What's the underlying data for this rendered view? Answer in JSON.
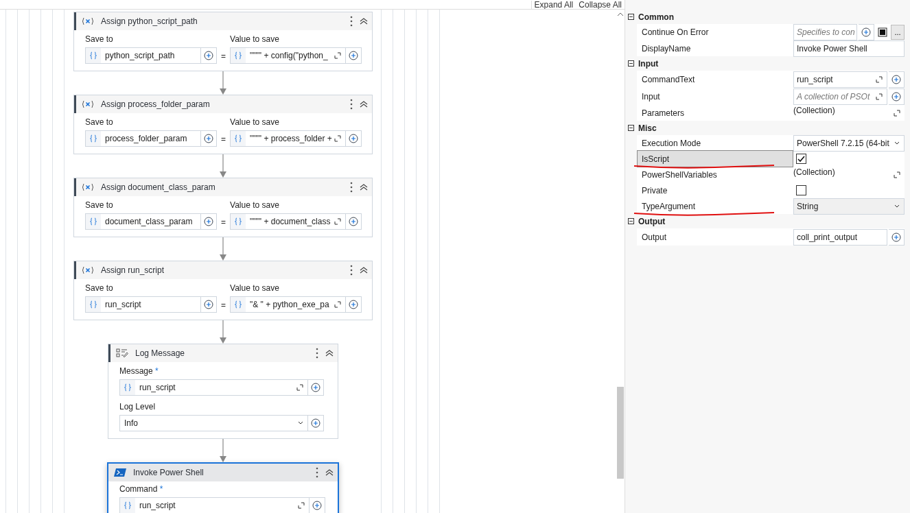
{
  "toolbar": {
    "expand_all": "Expand All",
    "collapse_all": "Collapse All"
  },
  "activities": [
    {
      "kind": "assign",
      "title": "Assign python_script_path",
      "selected": false,
      "save_to_label": "Save to",
      "value_label": "Value to save",
      "save_to": "python_script_path",
      "equals": "=",
      "value": "\"\"\"\" + config(\"python_"
    },
    {
      "kind": "assign",
      "title": "Assign process_folder_param",
      "selected": false,
      "save_to_label": "Save to",
      "value_label": "Value to save",
      "save_to": "process_folder_param",
      "equals": "=",
      "value": "\"\"\"\" + process_folder +"
    },
    {
      "kind": "assign",
      "title": "Assign document_class_param",
      "selected": false,
      "save_to_label": "Save to",
      "value_label": "Value to save",
      "save_to": "document_class_param",
      "equals": "=",
      "value": "\"\"\"\" + document_class"
    },
    {
      "kind": "assign",
      "title": "Assign run_script",
      "selected": false,
      "save_to_label": "Save to",
      "value_label": "Value to save",
      "save_to": "run_script",
      "equals": "=",
      "value": "\"& \" + python_exe_pa"
    },
    {
      "kind": "log",
      "title": "Log Message",
      "selected": false,
      "message_label": "Message",
      "required_mark": "*",
      "message": "run_script",
      "level_label": "Log Level",
      "level": "Info"
    },
    {
      "kind": "powershell",
      "title": "Invoke Power Shell",
      "selected": true,
      "command_label": "Command",
      "required_mark": "*",
      "command": "run_script"
    }
  ],
  "properties": {
    "sections": [
      {
        "title": "Common",
        "expanded": true,
        "rows": [
          {
            "kind": "toggle",
            "label": "Continue On Error",
            "placeholder": "Specifies to con",
            "ellipsis": "...",
            "selected": false,
            "annotated": false
          },
          {
            "kind": "text",
            "label": "DisplayName",
            "value": "Invoke Power Shell",
            "selected": false,
            "annotated": false
          }
        ]
      },
      {
        "title": "Input",
        "expanded": true,
        "rows": [
          {
            "kind": "expression",
            "label": "CommandText",
            "value": "run_script",
            "selected": false,
            "annotated": false
          },
          {
            "kind": "expression",
            "label": "Input",
            "placeholder": "A collection of PSOt",
            "selected": false,
            "annotated": false
          },
          {
            "kind": "collection",
            "label": "Parameters",
            "value": "(Collection)",
            "selected": false,
            "annotated": false
          }
        ]
      },
      {
        "title": "Misc",
        "expanded": true,
        "rows": [
          {
            "kind": "dropdown",
            "label": "Execution Mode",
            "value": "PowerShell 7.2.15 (64-bit",
            "selected": false,
            "annotated": false
          },
          {
            "kind": "checkbox",
            "label": "IsScript",
            "checked": true,
            "selected": true,
            "annotated": true
          },
          {
            "kind": "collection",
            "label": "PowerShellVariables",
            "value": "(Collection)",
            "selected": false,
            "annotated": false
          },
          {
            "kind": "checkbox",
            "label": "Private",
            "checked": false,
            "selected": false,
            "annotated": false
          },
          {
            "kind": "dropdown",
            "label": "TypeArgument",
            "value": "String",
            "selected": false,
            "annotated": true
          }
        ]
      },
      {
        "title": "Output",
        "expanded": true,
        "rows": [
          {
            "kind": "variable",
            "label": "Output",
            "value": "coll_print_output",
            "selected": false,
            "annotated": false
          }
        ]
      }
    ]
  }
}
